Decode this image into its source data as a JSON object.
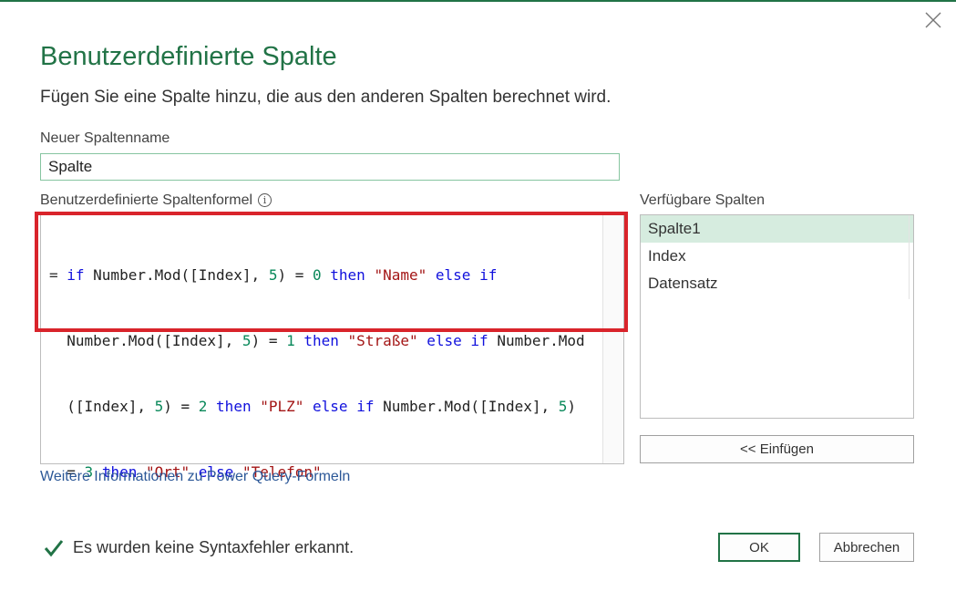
{
  "dialog": {
    "title": "Benutzerdefinierte Spalte",
    "subtitle": "Fügen Sie eine Spalte hinzu, die aus den anderen Spalten berechnet wird.",
    "close_icon": "close-icon"
  },
  "column_name": {
    "label": "Neuer Spaltenname",
    "value": "Spalte"
  },
  "formula": {
    "label": "Benutzerdefinierte Spaltenformel",
    "info_icon": "info-icon",
    "line1": [
      "= ",
      "if",
      " Number.Mod([Index], ",
      "5",
      ") = ",
      "0",
      " ",
      "then",
      " ",
      "\"Name\"",
      " ",
      "else",
      " ",
      "if"
    ],
    "line2": [
      "  Number.Mod([Index], ",
      "5",
      ") = ",
      "1",
      " ",
      "then",
      " ",
      "\"Straße\"",
      " ",
      "else",
      " ",
      "if",
      " Number.Mod"
    ],
    "line3": [
      "  ([Index], ",
      "5",
      ") = ",
      "2",
      " ",
      "then",
      " ",
      "\"PLZ\"",
      " ",
      "else",
      " ",
      "if",
      " Number.Mod([Index], ",
      "5",
      ")"
    ],
    "line4": [
      "  = ",
      "3",
      " ",
      "then",
      " ",
      "\"Ort\"",
      " ",
      "else",
      " ",
      "\"Telefon\""
    ]
  },
  "available_columns": {
    "label": "Verfügbare Spalten",
    "items": [
      "Spalte1",
      "Index",
      "Datensatz"
    ],
    "selected_index": 0
  },
  "insert_button": "<< Einfügen",
  "help_link": "Weitere Informationen zu Power Query-Formeln",
  "status": {
    "icon": "checkmark-icon",
    "text": "Es wurden keine Syntaxfehler erkannt."
  },
  "buttons": {
    "ok": "OK",
    "cancel": "Abbrechen"
  },
  "colors": {
    "accent": "#217346",
    "keyword": "#1111dd",
    "number": "#09885a",
    "string": "#a31515",
    "highlight_border": "#d9242b"
  }
}
